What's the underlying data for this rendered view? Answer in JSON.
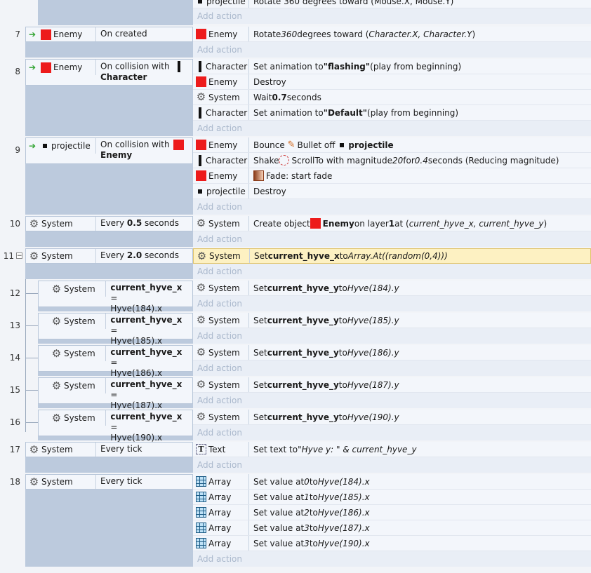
{
  "lines": {
    "l7": "7",
    "l8": "8",
    "l9": "9",
    "l10": "10",
    "l11": "11",
    "l12": "12",
    "l13": "13",
    "l14": "14",
    "l15": "15",
    "l16": "16",
    "l17": "17",
    "l18": "18"
  },
  "add_action": "Add action",
  "top": {
    "action_obj": "projectile",
    "action_text": "Rotate 360 degrees toward (Mouse.X, Mouse.Y)"
  },
  "e7": {
    "obj": "Enemy",
    "cond": "On created",
    "a1": {
      "obj": "Enemy",
      "pre": "Rotate ",
      "num": "360",
      "mid": " degrees toward (",
      "args": "Character.X, Character.Y",
      "post": ")"
    }
  },
  "e8": {
    "obj": "Enemy",
    "cond1": "On collision with",
    "cond2": "Character",
    "a1": {
      "obj": "Character",
      "pre": "Set animation to ",
      "val": "\"flashing\"",
      "post": " (play from beginning)"
    },
    "a2": {
      "obj": "Enemy",
      "text": "Destroy"
    },
    "a3": {
      "obj": "System",
      "pre": "Wait ",
      "val": "0.7",
      "post": " seconds"
    },
    "a4": {
      "obj": "Character",
      "pre": "Set animation to ",
      "val": "\"Default\"",
      "post": " (play from beginning)"
    }
  },
  "e9": {
    "obj": "projectile",
    "cond1": "On collision with",
    "cond2": "Enemy",
    "a1": {
      "obj": "Enemy",
      "pre": "Bounce ",
      "mid": "Bullet off ",
      "val": "projectile"
    },
    "a2": {
      "obj": "Character",
      "pre": "Shake ",
      "mid": "ScrollTo with magnitude ",
      "n1": "20",
      "m2": " for ",
      "n2": "0.4",
      "post": " seconds (Reducing magnitude)"
    },
    "a3": {
      "obj": "Enemy",
      "text": "Fade: start fade"
    },
    "a4": {
      "obj": "projectile",
      "text": "Destroy"
    }
  },
  "e10": {
    "obj": "System",
    "cond_pre": "Every ",
    "cond_val": "0.5",
    "cond_post": " seconds",
    "a1": {
      "obj": "System",
      "pre": "Create object ",
      "val": "Enemy",
      "mid": " on layer ",
      "layer": "1",
      "m2": " at (",
      "args": "current_hyve_x, current_hyve_y",
      "post": ")"
    }
  },
  "e11": {
    "obj": "System",
    "cond_pre": "Every ",
    "cond_val": "2.0",
    "cond_post": " seconds",
    "a1": {
      "obj": "System",
      "pre": "Set ",
      "val": "current_hyve_x",
      "mid": " to ",
      "expr": "Array.At((random(0,4)))"
    }
  },
  "subs": [
    {
      "obj": "System",
      "var": "current_hyve_x",
      "eq": " =",
      "expr": "Hyve(184).x",
      "aobj": "System",
      "apre": "Set ",
      "aval": "current_hyve_y",
      "amid": " to ",
      "aexpr": "Hyve(184).y"
    },
    {
      "obj": "System",
      "var": "current_hyve_x",
      "eq": " =",
      "expr": "Hyve(185).x",
      "aobj": "System",
      "apre": "Set ",
      "aval": "current_hyve_y",
      "amid": " to ",
      "aexpr": "Hyve(185).y"
    },
    {
      "obj": "System",
      "var": "current_hyve_x",
      "eq": " =",
      "expr": "Hyve(186).x",
      "aobj": "System",
      "apre": "Set ",
      "aval": "current_hyve_y",
      "amid": " to ",
      "aexpr": "Hyve(186).y"
    },
    {
      "obj": "System",
      "var": "current_hyve_x",
      "eq": " =",
      "expr": "Hyve(187).x",
      "aobj": "System",
      "apre": "Set ",
      "aval": "current_hyve_y",
      "amid": " to ",
      "aexpr": "Hyve(187).y"
    },
    {
      "obj": "System",
      "var": "current_hyve_x",
      "eq": " =",
      "expr": "Hyve(190).x",
      "aobj": "System",
      "apre": "Set ",
      "aval": "current_hyve_y",
      "amid": " to ",
      "aexpr": "Hyve(190).y"
    }
  ],
  "e17": {
    "obj": "System",
    "cond": "Every tick",
    "a1": {
      "obj": "Text",
      "pre": "Set text to ",
      "expr": "\"Hyve y: \" & current_hyve_y"
    }
  },
  "e18": {
    "obj": "System",
    "cond": "Every tick",
    "rows": [
      {
        "obj": "Array",
        "pre": "Set value at ",
        "idx": "0",
        "mid": " to ",
        "expr": "Hyve(184).x"
      },
      {
        "obj": "Array",
        "pre": "Set value at ",
        "idx": "1",
        "mid": " to ",
        "expr": "Hyve(185).x"
      },
      {
        "obj": "Array",
        "pre": "Set value at ",
        "idx": "2",
        "mid": " to ",
        "expr": "Hyve(186).x"
      },
      {
        "obj": "Array",
        "pre": "Set value at ",
        "idx": "3",
        "mid": " to ",
        "expr": "Hyve(187).x"
      },
      {
        "obj": "Array",
        "pre": "Set value at ",
        "idx": "3",
        "mid": " to ",
        "expr": "Hyve(190).x"
      }
    ]
  }
}
